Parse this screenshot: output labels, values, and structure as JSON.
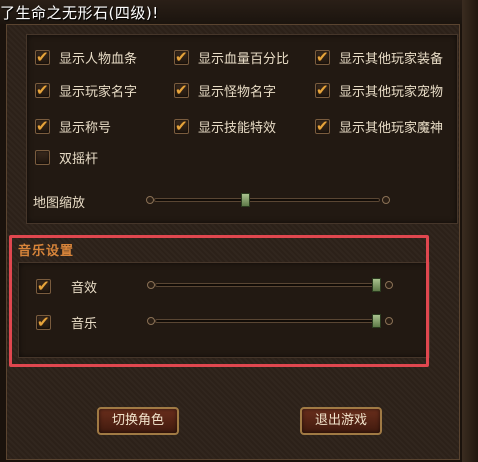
{
  "window": {
    "title": "了生命之无形石(四级)!"
  },
  "display": {
    "checkboxes": [
      {
        "label": "显示人物血条",
        "checked": true
      },
      {
        "label": "显示血量百分比",
        "checked": true
      },
      {
        "label": "显示其他玩家装备",
        "checked": true
      },
      {
        "label": "显示玩家名字",
        "checked": true
      },
      {
        "label": "显示怪物名字",
        "checked": true
      },
      {
        "label": "显示其他玩家宠物",
        "checked": true
      },
      {
        "label": "显示称号",
        "checked": true
      },
      {
        "label": "显示技能特效",
        "checked": true
      },
      {
        "label": "显示其他玩家魔神",
        "checked": true
      },
      {
        "label": "双摇杆",
        "checked": false
      }
    ],
    "map_zoom": {
      "label": "地图缩放",
      "value": 0.4
    }
  },
  "music": {
    "title": "音乐设置",
    "sound_effect": {
      "label": "音效",
      "checked": true,
      "value": 1.0
    },
    "music": {
      "label": "音乐",
      "checked": true,
      "value": 1.0
    }
  },
  "buttons": {
    "switch_role": "切换角色",
    "exit_game": "退出游戏"
  },
  "colors": {
    "accent_orange": "#e6a43c",
    "section_title": "#d7843a",
    "highlight_box": "#e0474f"
  }
}
